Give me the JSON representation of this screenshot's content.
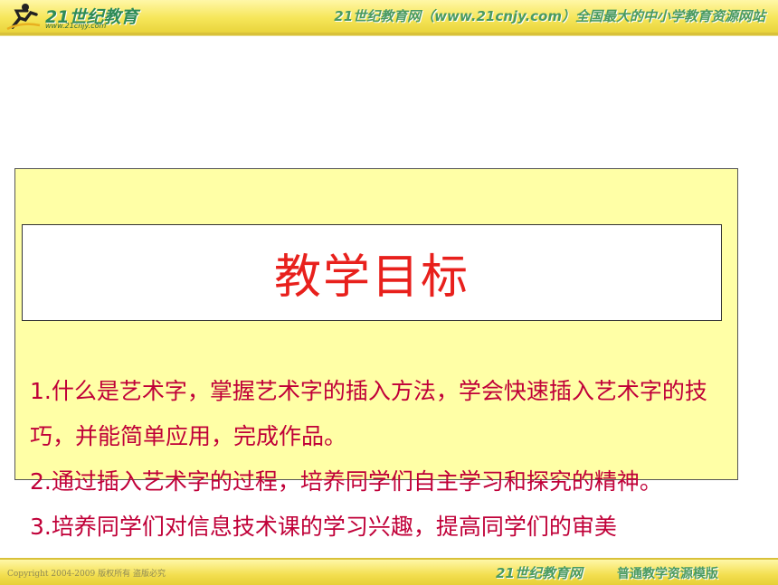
{
  "header": {
    "logo_text": "21世纪教育",
    "logo_url": "www.21cnjy.com",
    "banner": "21世纪教育网（www.21cnjy.com）全国最大的中小学教育资源网站"
  },
  "content": {
    "title": "教学目标",
    "objectives": [
      "1.什么是艺术字，掌握艺术字的插入方法，学会快速插入艺术字的技巧，并能简单应用，完成作品。",
      "2.通过插入艺术字的过程，培养同学们自主学习和探究的精神。",
      "3.培养同学们对信息技术课的学习兴趣，提高同学们的审美"
    ]
  },
  "footer": {
    "copyright": "Copyright 2004-2009 版权所有 盗版必究",
    "brand": "21世纪教育网",
    "tag": "普通教学资源模版"
  },
  "colors": {
    "title": "#e8201c",
    "objectives": "#c00038",
    "box_fill": "#ffffa6",
    "banner_green": "#4a9a60"
  }
}
